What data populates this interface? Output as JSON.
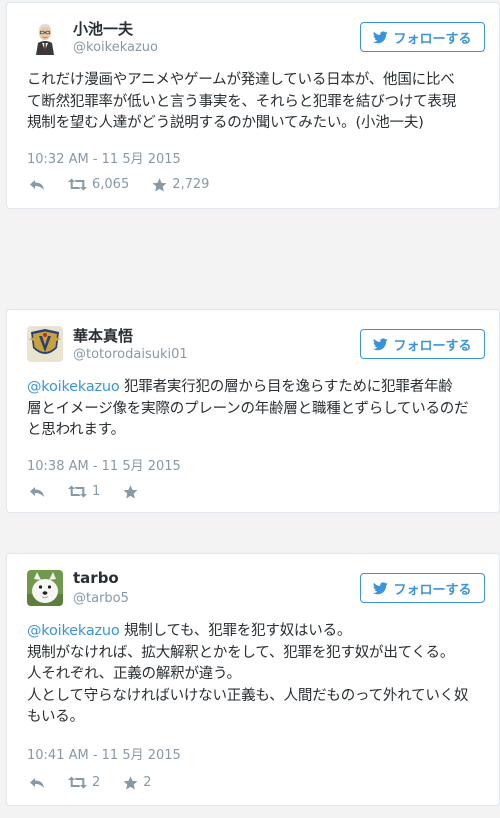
{
  "colors": {
    "link": "#3b94d9",
    "muted": "#8899a6",
    "border": "#e1e8ed"
  },
  "follow_button": {
    "icon": "bird-icon",
    "label": "フォローする"
  },
  "tweets": [
    {
      "avatar": "avatar-elderly-man",
      "name": "小池一夫",
      "handle": "@koikekazuo",
      "lines": [
        "これだけ漫画やアニメやゲームが発達している日本が、他国に比べ",
        "て断然犯罪率が低いと言う事実を、それらと犯罪を結びつけて表現",
        "規制を望む人達がどう説明するのか聞いてみたい。(小池一夫)"
      ],
      "timestamp": "10:32 AM - 11 5月 2015",
      "retweets": "6,065",
      "favorites": "2,729"
    },
    {
      "avatar": "avatar-emblem",
      "name": "華本真悟",
      "handle": "@totorodaisuki01",
      "mention": "@koikekazuo",
      "lines": [
        " 犯罪者実行犯の層から目を逸らすために犯罪者年齢",
        "層とイメージ像を実際のプレーンの年齢層と職種とずらしているのだ",
        "と思われます。"
      ],
      "timestamp": "10:38 AM - 11 5月 2015",
      "retweets": "1",
      "favorites": ""
    },
    {
      "avatar": "avatar-white-dog",
      "name": "tarbo",
      "handle": "@tarbo5",
      "mention": "@koikekazuo",
      "lines": [
        " 規制しても、犯罪を犯す奴はいる。",
        "規制がなければ、拡大解釈とかをして、犯罪を犯す奴が出てくる。",
        "人それぞれ、正義の解釈が違う。",
        "人として守らなければいけない正義も、人間だものって外れていく奴",
        "もいる。"
      ],
      "timestamp": "10:41 AM - 11 5月 2015",
      "retweets": "2",
      "favorites": "2"
    }
  ]
}
